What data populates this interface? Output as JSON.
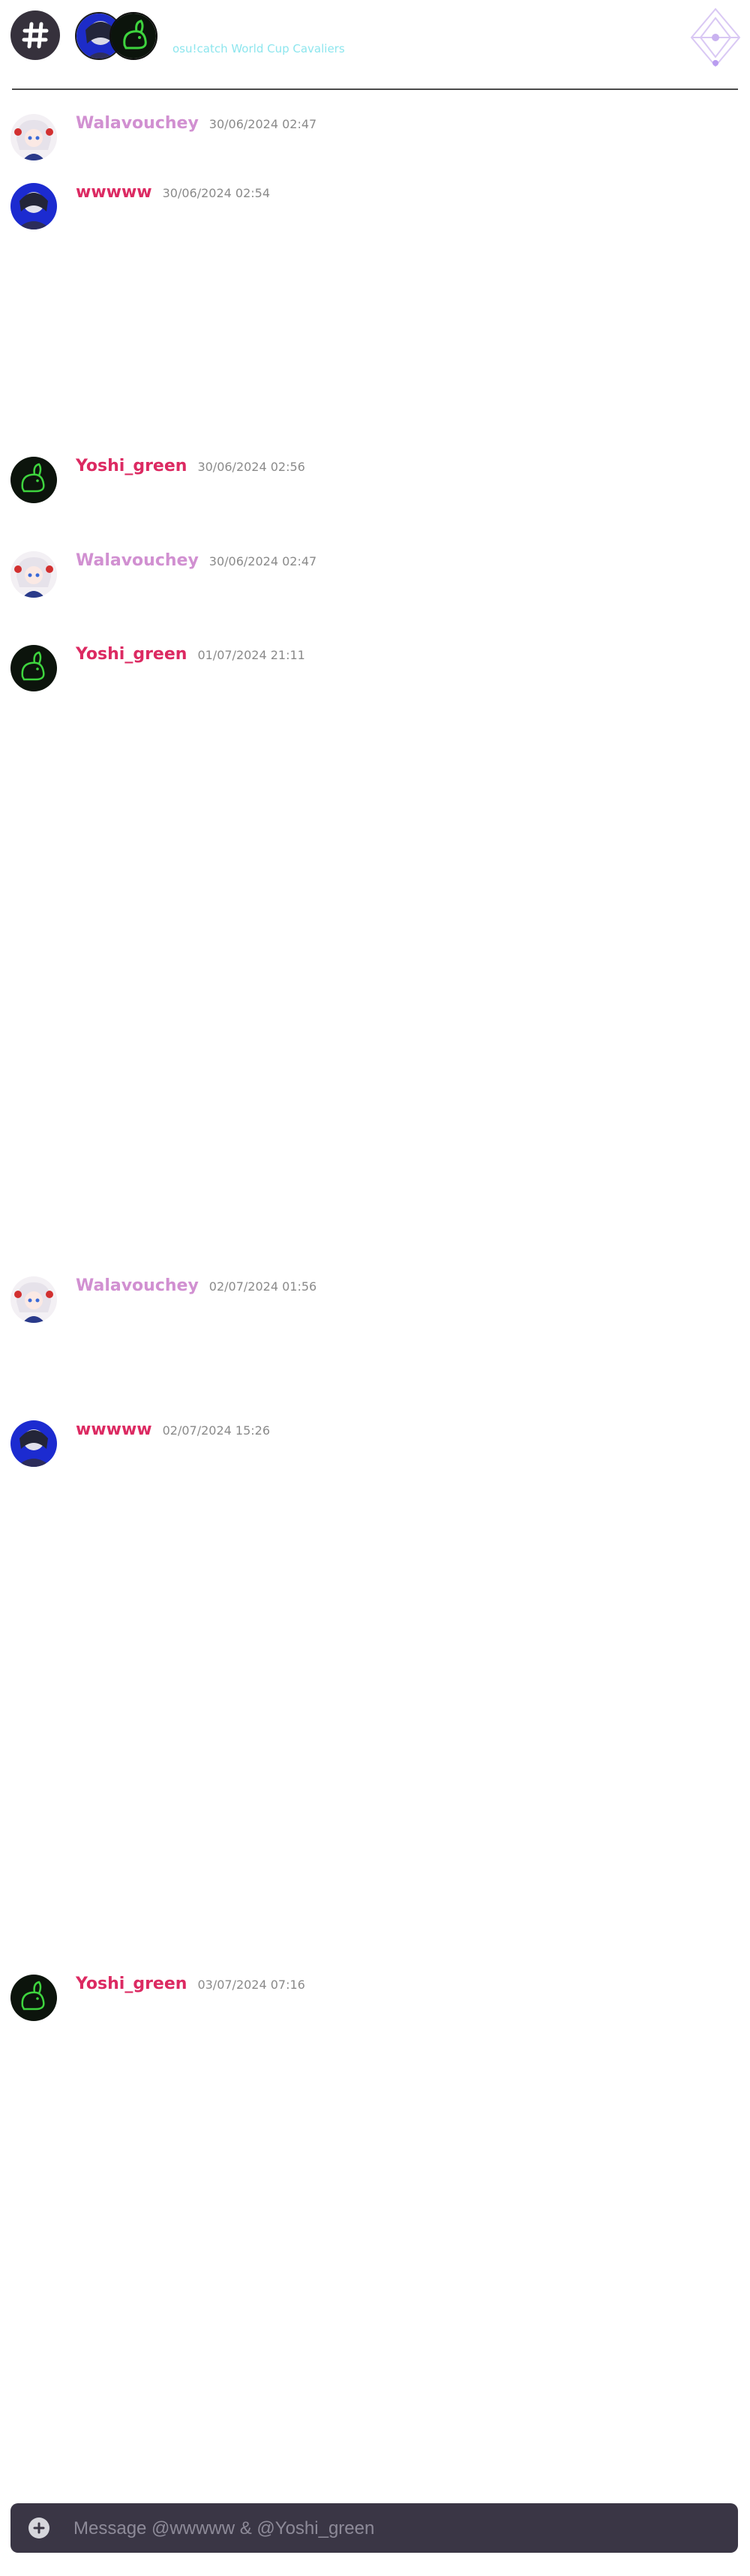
{
  "header": {
    "channel_icon": "hash-icon",
    "title": "",
    "subtitle": "osu!catch World Cup Cavaliers",
    "emblem_icon": "diamond-crest-icon"
  },
  "users": {
    "wala": {
      "name": "Walavouchey",
      "color": "#d190d1",
      "avatar": "white-haired-girl-avatar"
    },
    "wwwww": {
      "name": "wwwww",
      "color": "#dc2a62",
      "avatar": "dark-haired-anime-avatar"
    },
    "yoshi": {
      "name": "Yoshi_green",
      "color": "#dc2a62",
      "avatar": "green-rabbit-avatar"
    }
  },
  "messages": [
    {
      "author": "Walavouchey",
      "timestamp": "30/06/2024 02:47"
    },
    {
      "author": "wwwww",
      "timestamp": "30/06/2024 02:54"
    },
    {
      "author": "Yoshi_green",
      "timestamp": "30/06/2024 02:56"
    },
    {
      "author": "Walavouchey",
      "timestamp": "30/06/2024 02:47"
    },
    {
      "author": "Yoshi_green",
      "timestamp": "01/07/2024 21:11"
    },
    {
      "author": "Walavouchey",
      "timestamp": "02/07/2024 01:56"
    },
    {
      "author": "wwwww",
      "timestamp": "02/07/2024 15:26"
    },
    {
      "author": "Yoshi_green",
      "timestamp": "03/07/2024 07:16"
    }
  ],
  "composer": {
    "placeholder": "Message @wwwww & @Yoshi_green",
    "add_icon": "plus-circle-icon"
  }
}
